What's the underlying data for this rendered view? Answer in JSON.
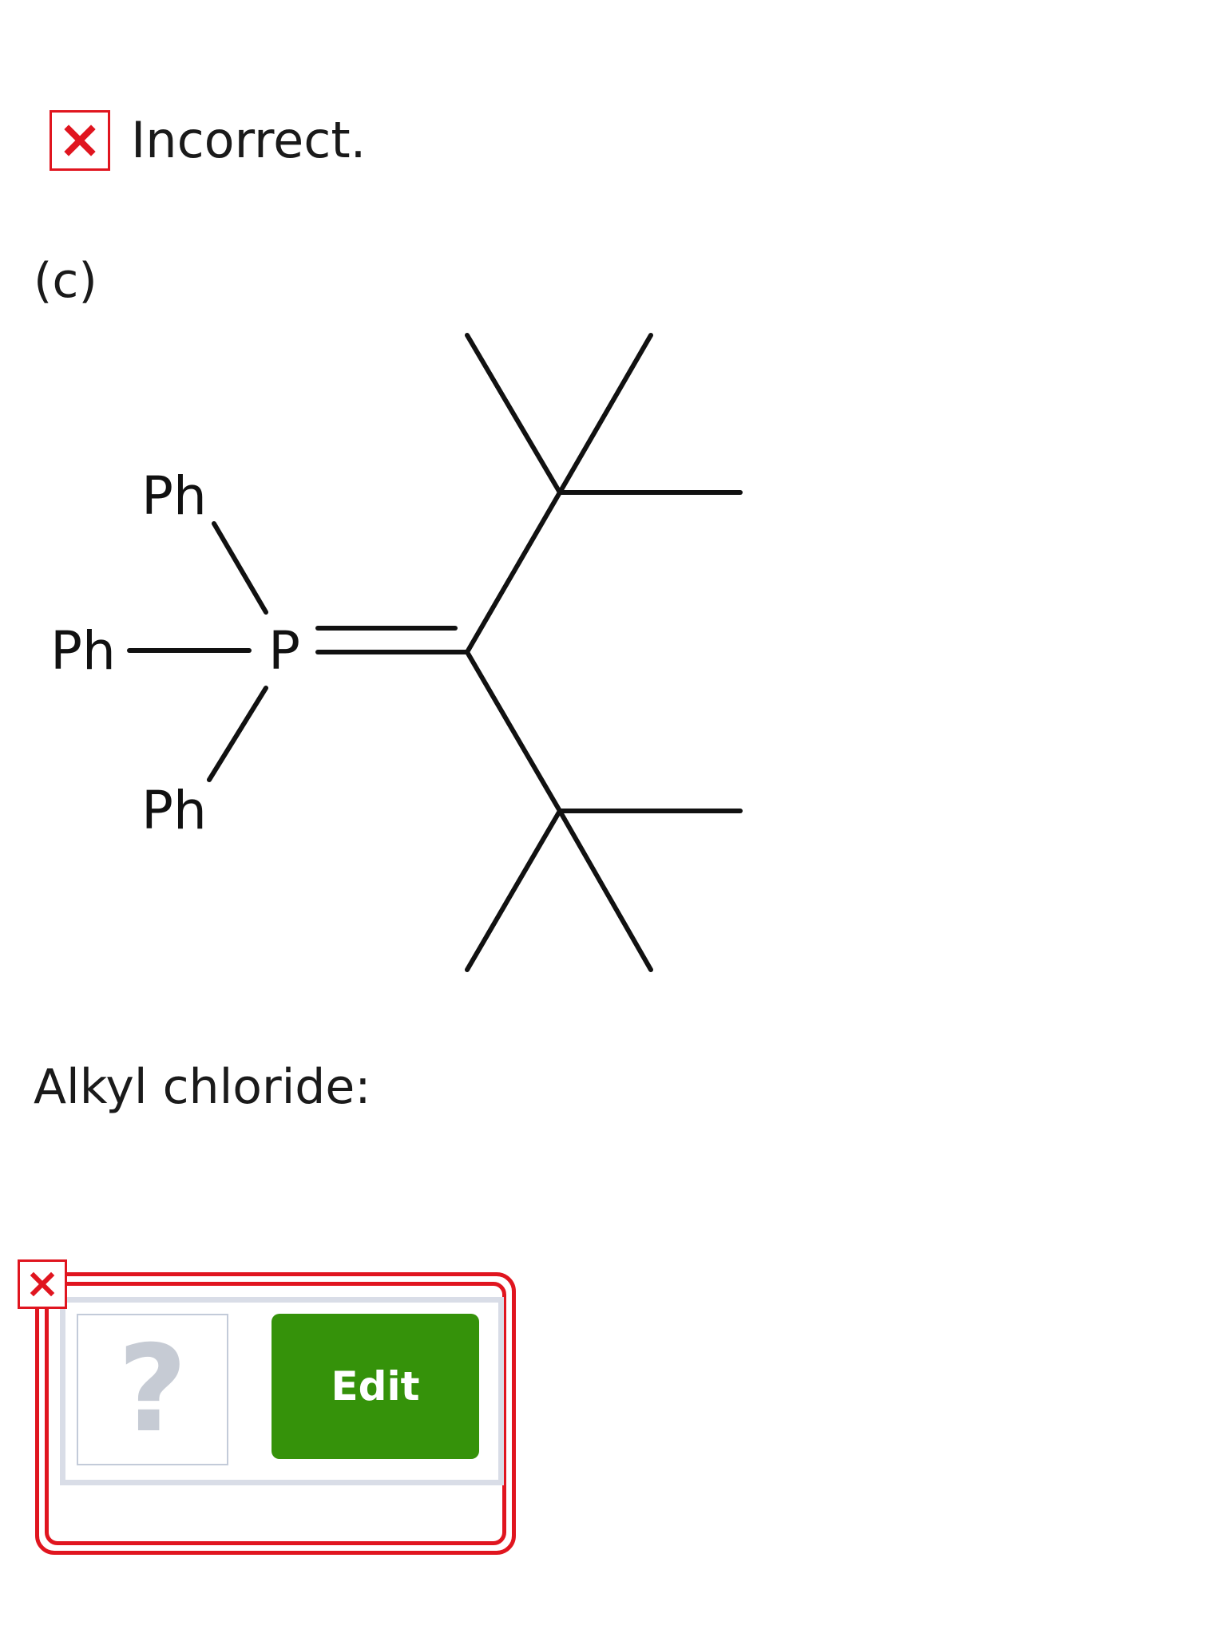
{
  "feedback": {
    "status_icon": "x-mark-icon",
    "text": "Incorrect."
  },
  "question": {
    "part_label": "(c)",
    "molecule": {
      "atom_labels": {
        "p": "P",
        "ph_top": "Ph",
        "ph_left": "Ph",
        "ph_bottom": "Ph"
      }
    },
    "answer_prompt": "Alkyl chloride:"
  },
  "answer": {
    "error_icon": "x-mark-icon",
    "placeholder": "?",
    "edit_label": "Edit"
  },
  "colors": {
    "error": "#e0151f",
    "edit_button": "#35920a",
    "panel_border": "#d9dde7",
    "placeholder": "#c6cbd4"
  }
}
